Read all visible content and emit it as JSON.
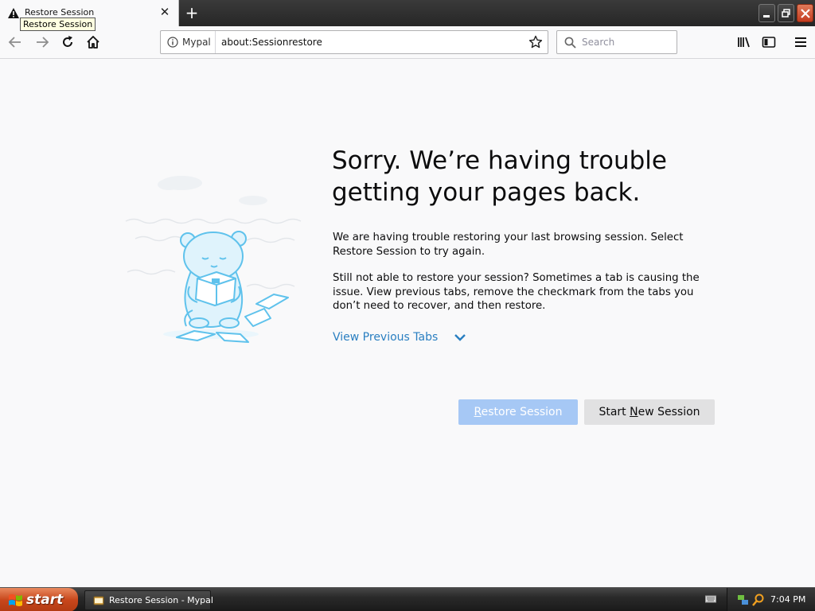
{
  "tab": {
    "title": "Restore Session",
    "tooltip": "Restore Session",
    "close_glyph": "✕",
    "icon": "warning-icon"
  },
  "new_tab_glyph": "+",
  "toolbar": {
    "identity_label": "Mypal",
    "url": "about:Sessionrestore",
    "search_placeholder": "Search"
  },
  "content": {
    "heading": "Sorry. We’re having trouble getting your pages back.",
    "para1": "We are having trouble restoring your last browsing session. Select Restore Session to try again.",
    "para2": "Still not able to restore your session? Sometimes a tab is causing the issue. View previous tabs, remove the checkmark from the tabs you don’t need to recover, and then restore.",
    "view_tabs": "View Previous Tabs",
    "restore_button": {
      "before": "",
      "access": "R",
      "after": "estore Session"
    },
    "new_button": {
      "before": "Start ",
      "access": "N",
      "after": "ew Session"
    }
  },
  "taskbar": {
    "start_label": "start",
    "task_label": "Restore Session - Mypal",
    "clock": "7:04 PM"
  },
  "colors": {
    "accent_link": "#2a7fc1",
    "primary_disabled": "#a6c8f5",
    "secondary_button": "#e1e1e2",
    "illustration": "#5fc2ec"
  }
}
